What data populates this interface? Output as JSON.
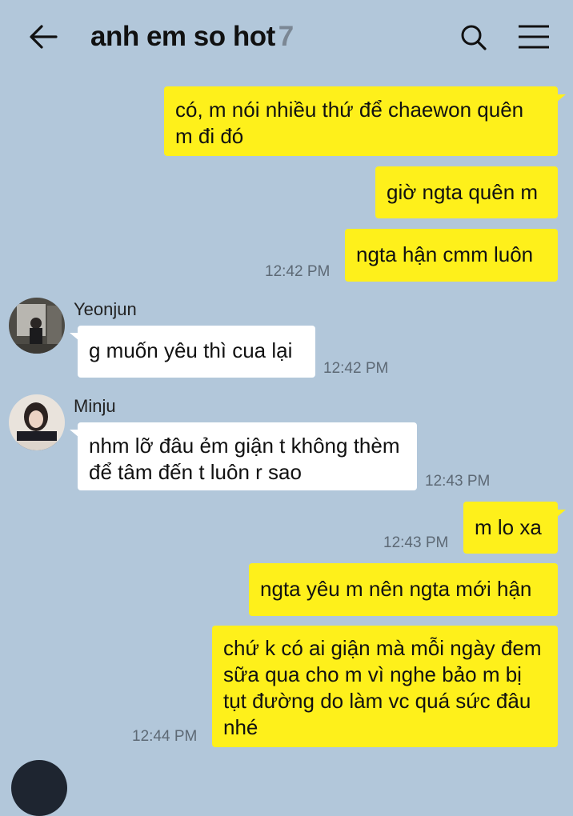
{
  "header": {
    "title": "anh em so hot",
    "member_count": "7",
    "back_icon": "arrow-left-icon",
    "search_icon": "search-icon",
    "menu_icon": "hamburger-menu-icon"
  },
  "colors": {
    "background": "#b2c7da",
    "my_bubble": "#fef01b",
    "other_bubble": "#ffffff",
    "timestamp": "#5d6975"
  },
  "messages": [
    {
      "from": "me",
      "text": "có, m nói nhiều thứ để chaewon quên m đi đó"
    },
    {
      "from": "me",
      "text": "giờ ngta quên m"
    },
    {
      "from": "me",
      "text": "ngta hận cmm luôn",
      "time": "12:42 PM"
    },
    {
      "from": "Yeonjun",
      "text": "g muốn yêu thì cua lại",
      "time": "12:42 PM"
    },
    {
      "from": "Minju",
      "text": "nhm lỡ đâu ẻm giận t không thèm để tâm đến t luôn r sao",
      "time": "12:43 PM"
    },
    {
      "from": "me",
      "text": "m lo xa",
      "time": "12:43 PM"
    },
    {
      "from": "me",
      "text": "ngta yêu m nên ngta mới hận"
    },
    {
      "from": "me",
      "text": "chứ k có ai giận mà mỗi ngày đem sữa qua cho m vì nghe bảo m bị tụt đường do làm vc quá sức đâu nhé",
      "time": "12:44 PM"
    }
  ]
}
